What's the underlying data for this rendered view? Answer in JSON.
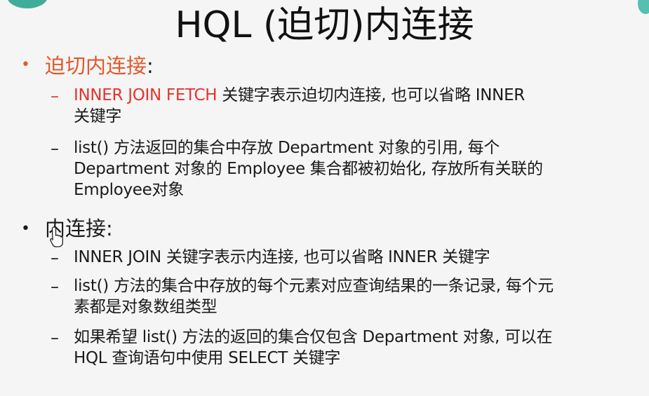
{
  "title": "HQL (迫切)内连接",
  "section1": {
    "bullet": "•",
    "heading": "迫切内连接",
    "heading_suffix": ":",
    "items": [
      {
        "dash": "–",
        "keyword": "INNER JOIN FETCH",
        "line1": " 关键字表示迫切内连接, 也可以省略 INNER",
        "line2": "关键字"
      },
      {
        "dash": "–",
        "line1": "list() 方法返回的集合中存放 Department 对象的引用, 每个",
        "line2": "Department 对象的 Employee 集合都被初始化, 存放所有关联的",
        "line3": "Employee对象"
      }
    ]
  },
  "section2": {
    "bullet": "•",
    "heading": "内连接:",
    "items": [
      {
        "dash": "–",
        "line1": "INNER JOIN 关键字表示内连接, 也可以省略 INNER 关键字"
      },
      {
        "dash": "–",
        "line1": "list() 方法的集合中存放的每个元素对应查询结果的一条记录, 每个元",
        "line2": "素都是对象数组类型"
      },
      {
        "dash": "–",
        "line1": "如果希望 list() 方法的返回的集合仅包含 Department  对象, 可以在",
        "line2": "HQL 查询语句中使用 SELECT 关键字"
      }
    ]
  },
  "colors": {
    "heading_accent": "#e2592a",
    "keyword_accent": "#e8322c",
    "text": "#1a1a1a",
    "corner": "#1ea08a"
  },
  "icons": {
    "cursor": "hand-pointer-icon"
  }
}
